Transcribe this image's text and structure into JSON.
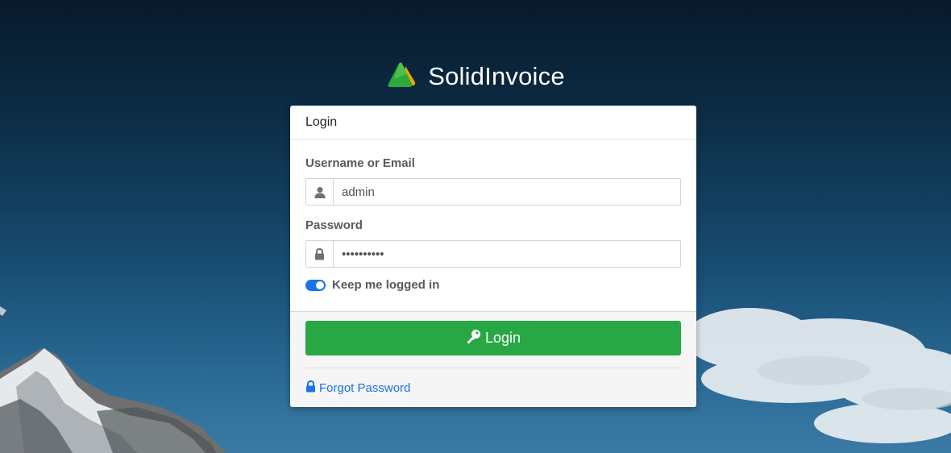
{
  "brand": {
    "name": "SolidInvoice",
    "logo_colors": [
      "#2ea83a",
      "#f0a500"
    ]
  },
  "login_card": {
    "title": "Login",
    "username": {
      "label": "Username or Email",
      "value": "admin",
      "icon": "user-icon"
    },
    "password": {
      "label": "Password",
      "value": "••••••••••",
      "icon": "lock-icon"
    },
    "remember": {
      "label": "Keep me logged in",
      "checked": true
    },
    "submit": {
      "label": "Login",
      "icon": "key-icon"
    },
    "forgot": {
      "label": "Forgot Password",
      "icon": "lock-icon"
    }
  },
  "colors": {
    "primary_button": "#28a745",
    "link": "#1a73e8",
    "toggle": "#1a73e8"
  }
}
